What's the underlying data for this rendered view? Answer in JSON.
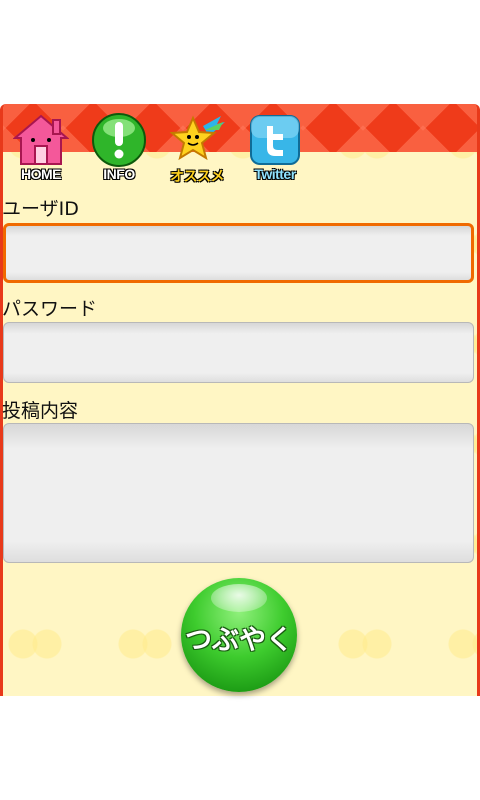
{
  "nav": {
    "items": [
      {
        "label": "HOME",
        "icon": "home-icon"
      },
      {
        "label": "INFO",
        "icon": "info-icon"
      },
      {
        "label": "オススメ",
        "icon": "star-icon"
      },
      {
        "label": "Twitter",
        "icon": "twitter-icon"
      }
    ]
  },
  "form": {
    "user_id_label": "ユーザID",
    "password_label": "パスワード",
    "content_label": "投稿内容",
    "submit_label": "つぶやく"
  },
  "colors": {
    "header_red": "#ef3b1a",
    "panel_bg": "#fff6c4",
    "focus_orange": "#f06a00",
    "button_green": "#3ecc2e"
  }
}
